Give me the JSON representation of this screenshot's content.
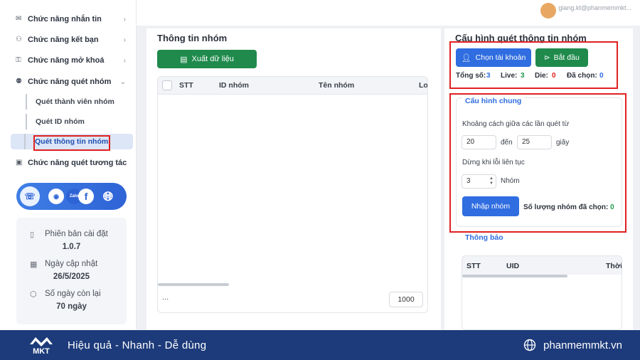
{
  "sidebar": {
    "items": [
      {
        "label": "Chức năng nhắn tin",
        "icon": "message-icon"
      },
      {
        "label": "Chức năng kết bạn",
        "icon": "add-friend-icon"
      },
      {
        "label": "Chức năng mở khoá",
        "icon": "unlock-icon"
      },
      {
        "label": "Chức năng quét nhóm",
        "icon": "group-icon"
      },
      {
        "label": "Chức năng quét tương tác",
        "icon": "interaction-icon"
      }
    ],
    "sub_items": [
      "Quét thành viên nhóm",
      "Quét ID nhóm",
      "Quét thông tin nhóm"
    ],
    "active_sub": "Quét thông tin nhóm",
    "social": [
      "support-icon",
      "messenger-icon",
      "zalo-icon",
      "facebook-icon",
      "web-icon"
    ],
    "zalo_text": "Zalo",
    "facebook_text": "f",
    "info": {
      "version_label": "Phiên bản cài đặt",
      "version_value": "1.0.7",
      "update_label": "Ngày cập nhật",
      "update_value": "26/5/2025",
      "days_label": "Số ngày còn lại",
      "days_value": "70 ngày"
    }
  },
  "topbar": {
    "user_text": "giang.kt@phanmemmkt..."
  },
  "left_panel": {
    "title": "Thông tin nhóm",
    "export_label": "Xuất dữ liệu",
    "columns": [
      "STT",
      "ID nhóm",
      "Tên nhóm",
      "Lo"
    ],
    "footer_text": "...",
    "page_size": "1000"
  },
  "right_panel": {
    "title": "Cấu hình quét thông tin nhóm",
    "choose_account_label": "Chọn tài khoản",
    "start_label": "Bắt đầu",
    "stats": {
      "total_label": "Tổng số:",
      "total_value": "3",
      "live_label": "Live:",
      "live_value": "3",
      "die_label": "Die:",
      "die_value": "0",
      "selected_label": "Đã chọn:",
      "selected_value": "0"
    },
    "config": {
      "legend": "Cấu hình chung",
      "interval_label": "Khoảng cách giữa các lần quét từ",
      "from_value": "20",
      "to_label": "đến",
      "to_value": "25",
      "unit_seconds": "giây",
      "stop_label": "Dừng khi lỗi liên tục",
      "stop_value": "3",
      "unit_groups": "Nhóm",
      "import_label": "Nhập nhóm",
      "selected_groups_label": "Số lượng nhóm đã chọn:",
      "selected_groups_value": "0"
    },
    "notice": {
      "legend": "Thông báo",
      "columns": [
        "STT",
        "UID",
        "Thời"
      ]
    }
  },
  "brand": {
    "logo_text": "MKT",
    "slogan": "Hiệu quả - Nhanh - Dễ dùng",
    "site": "phanmemmkt.vn"
  },
  "colors": {
    "primary_blue": "#2f6de0",
    "green": "#1f8a4c",
    "highlight_red": "#e02020",
    "brand_navy": "#1d3b7a"
  }
}
